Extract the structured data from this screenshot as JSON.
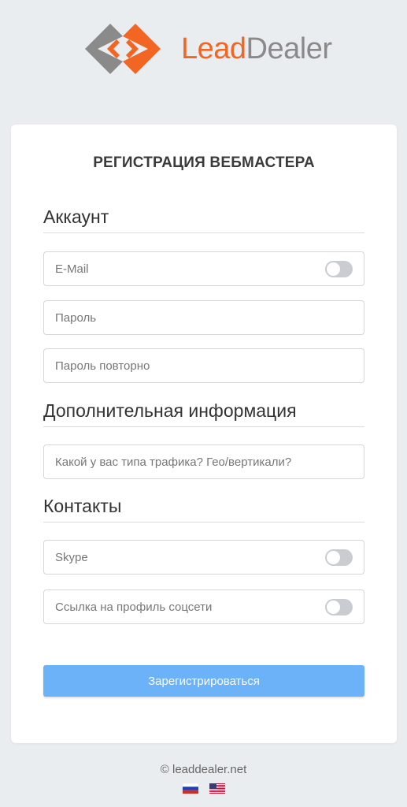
{
  "brand": {
    "lead": "Lead",
    "dealer": "Dealer",
    "colors": {
      "orange": "#f26522",
      "gray": "#8a8a8a"
    }
  },
  "form": {
    "title": "РЕГИСТРАЦИЯ ВЕБМАСТЕРА",
    "sections": {
      "account": "Аккаунт",
      "additional": "Дополнительная информация",
      "contacts": "Контакты"
    },
    "fields": {
      "email": {
        "placeholder": "E-Mail",
        "value": "",
        "toggle": "off"
      },
      "password": {
        "placeholder": "Пароль",
        "value": ""
      },
      "password_repeat": {
        "placeholder": "Пароль повторно",
        "value": ""
      },
      "traffic": {
        "placeholder": "Какой у вас типа трафика? Гео/вертикали?",
        "value": ""
      },
      "skype": {
        "placeholder": "Skype",
        "value": "",
        "toggle": "off"
      },
      "social": {
        "placeholder": "Ссылка на профиль соцсети",
        "value": "",
        "toggle": "off"
      }
    },
    "submit_label": "Зарегистрироваться",
    "submit_color": "#6cb2f8"
  },
  "footer": {
    "copyright": "© leaddealer.net",
    "languages": [
      "ru-flag-icon",
      "us-flag-icon"
    ]
  }
}
